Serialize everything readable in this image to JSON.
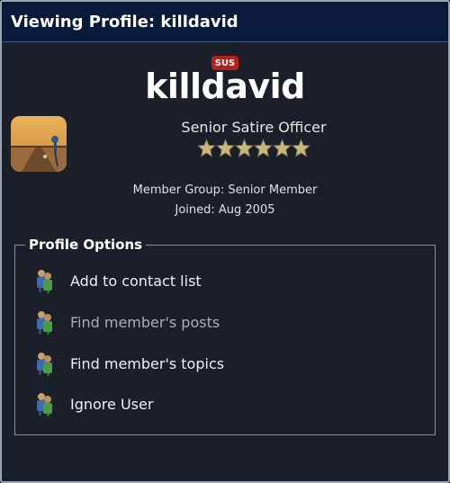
{
  "title": "Viewing Profile: killdavid",
  "profile": {
    "badge": "SUS",
    "username": "killdavid",
    "member_title": "Senior Satire Officer",
    "star_count": 6,
    "member_group": "Member Group: Senior Member",
    "joined": "Joined: Aug 2005"
  },
  "options": {
    "legend": "Profile Options",
    "items": [
      {
        "label": "Add to contact list",
        "icon": "people-icon"
      },
      {
        "label": "Find member's posts",
        "icon": "people-icon"
      },
      {
        "label": "Find member's topics",
        "icon": "people-icon"
      },
      {
        "label": "Ignore User",
        "icon": "people-icon"
      }
    ]
  },
  "colors": {
    "title_bar": "#0a1a3a",
    "background": "#1a1f29",
    "badge": "#b3211d",
    "star": "#c8b67a"
  }
}
